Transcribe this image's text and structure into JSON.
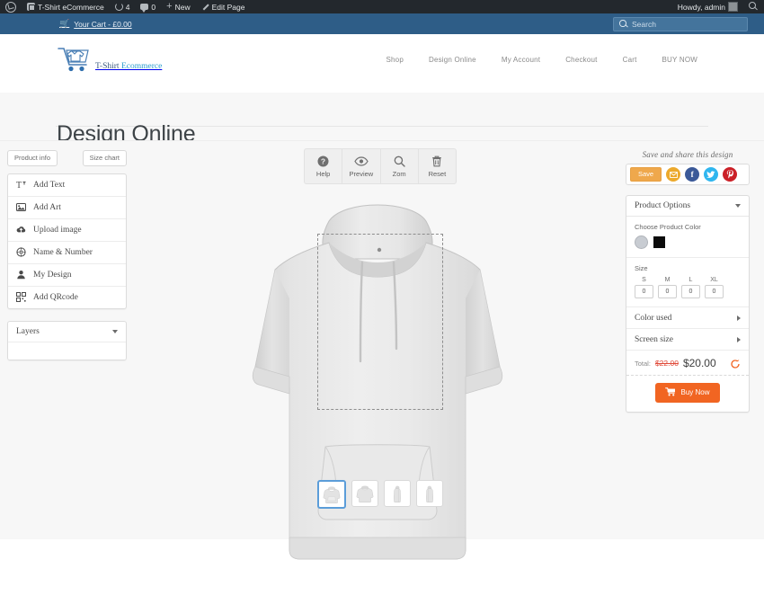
{
  "adminbar": {
    "items": [
      {
        "icon": "wordpress-logo-icon",
        "label": ""
      },
      {
        "icon": "site-icon",
        "label": "T-Shirt eCommerce"
      },
      {
        "icon": "revisions-icon",
        "label": "4"
      },
      {
        "icon": "comments-icon",
        "label": "0"
      },
      {
        "icon": "plus-icon",
        "label": "New"
      },
      {
        "icon": "pencil-icon",
        "label": "Edit Page"
      }
    ],
    "howdy": "Howdy, admin"
  },
  "cartbar": {
    "cart_label": "Your Cart - £0.00",
    "search_placeholder": "Search",
    "search_value": ""
  },
  "header": {
    "logo_text_primary": "T-Shirt ",
    "logo_text_accent": "Ecommerce",
    "nav": [
      {
        "label": "Shop"
      },
      {
        "label": "Design Online"
      },
      {
        "label": "My Account"
      },
      {
        "label": "Checkout"
      },
      {
        "label": "Cart"
      },
      {
        "label": "BUY NOW"
      }
    ]
  },
  "page": {
    "title": "Design Online"
  },
  "left": {
    "tabs": [
      {
        "label": "Product info"
      },
      {
        "label": "Size chart"
      }
    ],
    "tools": [
      {
        "label": "Add Text",
        "icon": "text-format-icon"
      },
      {
        "label": "Add Art",
        "icon": "image-icon"
      },
      {
        "label": "Upload image",
        "icon": "cloud-upload-icon"
      },
      {
        "label": "Name & Number",
        "icon": "target-icon"
      },
      {
        "label": "My Design",
        "icon": "user-icon"
      },
      {
        "label": "Add QRcode",
        "icon": "qrcode-icon"
      }
    ],
    "layers_label": "Layers"
  },
  "stage": {
    "tools": [
      {
        "label": "Help",
        "icon": "question-circle-icon"
      },
      {
        "label": "Preview",
        "icon": "eye-icon"
      },
      {
        "label": "Zom",
        "icon": "magnifier-icon"
      },
      {
        "label": "Reset",
        "icon": "trash-icon"
      }
    ],
    "thumbnails": [
      {
        "name": "front-view",
        "selected": true
      },
      {
        "name": "back-view",
        "selected": false
      },
      {
        "name": "left-view",
        "selected": false
      },
      {
        "name": "right-view",
        "selected": false
      }
    ]
  },
  "right": {
    "share_title": "Save and share this design",
    "save_label": "Save",
    "social": [
      {
        "name": "email-share-icon",
        "glyph": "✉",
        "color": "#eca92c"
      },
      {
        "name": "facebook-share-icon",
        "glyph": "f",
        "color": "#3b5998"
      },
      {
        "name": "twitter-share-icon",
        "glyph": "ᵗ",
        "color": "#2fb6ef"
      },
      {
        "name": "pinterest-share-icon",
        "glyph": "℗",
        "color": "#cb2027"
      }
    ],
    "options_title": "Product Options",
    "color_label": "Choose Product Color",
    "colors": [
      {
        "name": "grey",
        "hex": "#c8ccd2",
        "shape": "circle"
      },
      {
        "name": "black",
        "hex": "#0c0c0c",
        "shape": "square"
      }
    ],
    "size_label": "Size",
    "sizes": [
      {
        "label": "S",
        "value": "0"
      },
      {
        "label": "M",
        "value": "0"
      },
      {
        "label": "L",
        "value": "0"
      },
      {
        "label": "XL",
        "value": "0"
      }
    ],
    "rows": [
      {
        "label": "Color used"
      },
      {
        "label": "Screen size"
      }
    ],
    "total_label": "Total:",
    "price_old": "$22.00",
    "price_new": "$20.00",
    "buy_label": "Buy Now"
  }
}
